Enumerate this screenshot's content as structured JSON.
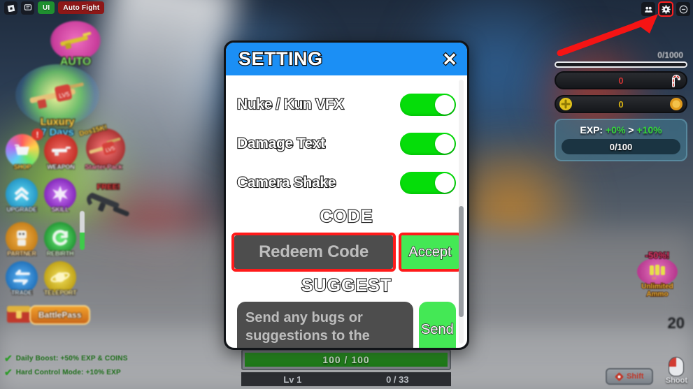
{
  "topbar": {
    "roblox_icon": "roblox-logo-icon",
    "chat_icon": "chat-icon",
    "ui_label": "UI",
    "auto_fight_label": "Auto Fight"
  },
  "topright": {
    "roster_icon": "people-roster-icon",
    "settings_icon": "gear-icon",
    "minimize_icon": "circle-minus-icon",
    "highlight_color": "#ff2020"
  },
  "sidebar": {
    "items": [
      {
        "label": "AUTO",
        "sub": "",
        "name": "auto-button"
      },
      {
        "label": "Luxury",
        "sub": "7 Days",
        "name": "luxury-7days-button"
      },
      {
        "label": "SHOP",
        "sub": "",
        "name": "shop-button"
      },
      {
        "label": "WEAPON",
        "sub": "",
        "name": "weapon-button"
      },
      {
        "label": "Starter Pack",
        "sub": "Dos15K!",
        "name": "starter-pack-button"
      },
      {
        "label": "UPGRADE",
        "sub": "",
        "name": "upgrade-button"
      },
      {
        "label": "SKILL",
        "sub": "",
        "name": "skill-button"
      },
      {
        "label": "PARTNER",
        "sub": "",
        "name": "partner-button"
      },
      {
        "label": "REBIRTH",
        "sub": "",
        "name": "rebirth-button"
      },
      {
        "label": "TRADE",
        "sub": "",
        "name": "trade-button"
      },
      {
        "label": "TELEPORT",
        "sub": "",
        "name": "teleport-button"
      },
      {
        "label": "BattlePass",
        "sub": "",
        "name": "battlepass-button"
      }
    ],
    "free_weapon_label": "FREE!"
  },
  "boosts": [
    {
      "text": "Daily Boost: +50% EXP & COINS"
    },
    {
      "text": "Hard Control Mode: +10% EXP"
    }
  ],
  "hud_right": {
    "top_bar_count": "0/1000",
    "gem_value": "0",
    "coin_value": "0",
    "exp_prefix": "EXP:",
    "exp_current": "+0%",
    "exp_arrow": ">",
    "exp_next": "+10%",
    "exp_progress": "0/100",
    "ad_badge_discount": "-50%!",
    "ad_badge_line1": "Unlimited",
    "ad_badge_line2": "Ammo"
  },
  "hud_bottom": {
    "health": "100 / 100",
    "level": "Lv 1",
    "level_progress": "0 / 33",
    "ammo": "20",
    "shift_key": "Shift",
    "shoot_label": "Shoot"
  },
  "modal": {
    "title": "SETTING",
    "close_label": "✕",
    "toggles": [
      {
        "label": "Nuke / Kun VFX",
        "on": true
      },
      {
        "label": "Damage Text",
        "on": true
      },
      {
        "label": "Camera Shake",
        "on": true
      }
    ],
    "code_section_title": "CODE",
    "code_placeholder": "Redeem Code",
    "code_value": "",
    "accept_label": "Accept",
    "suggest_section_title": "SUGGEST",
    "suggest_placeholder": "Send any bugs or suggestions to the",
    "suggest_value": "",
    "send_label": "Send"
  },
  "colors": {
    "header_blue": "#1b8ff5",
    "toggle_green": "#05dd09",
    "button_green": "#44e855",
    "highlight_red": "#ff1a1a",
    "input_gray": "#4d4d4d"
  }
}
